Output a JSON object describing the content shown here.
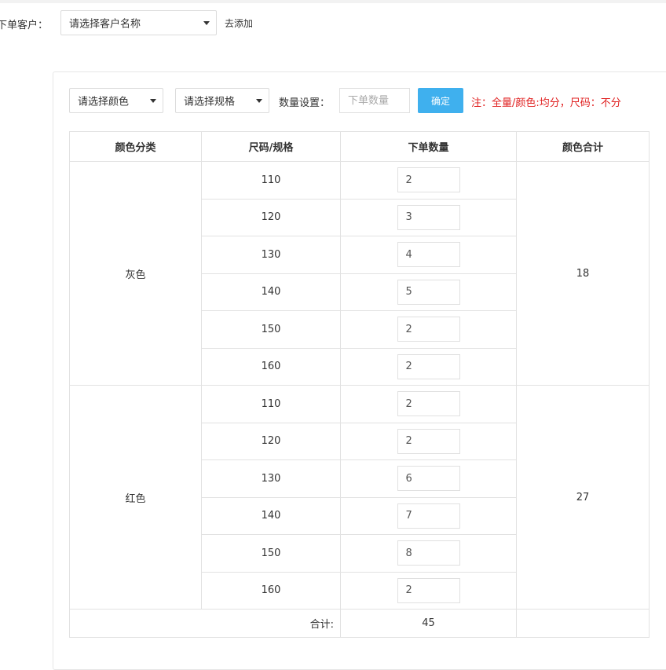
{
  "customer": {
    "label": "下单客户：",
    "select_value": "请选择客户名称",
    "add_link": "去添加"
  },
  "toolbar": {
    "color_select": "请选择颜色",
    "spec_select": "请选择规格",
    "qty_label": "数量设置：",
    "qty_placeholder": "下单数量",
    "confirm_label": "确定",
    "note": "注：全量/颜色:均分，尺码：不分"
  },
  "table": {
    "headers": [
      "颜色分类",
      "尺码/规格",
      "下单数量",
      "颜色合计"
    ],
    "groups": [
      {
        "color": "灰色",
        "subtotal": "18",
        "rows": [
          {
            "size": "110",
            "qty": "2"
          },
          {
            "size": "120",
            "qty": "3"
          },
          {
            "size": "130",
            "qty": "4"
          },
          {
            "size": "140",
            "qty": "5"
          },
          {
            "size": "150",
            "qty": "2"
          },
          {
            "size": "160",
            "qty": "2"
          }
        ]
      },
      {
        "color": "红色",
        "subtotal": "27",
        "rows": [
          {
            "size": "110",
            "qty": "2"
          },
          {
            "size": "120",
            "qty": "2"
          },
          {
            "size": "130",
            "qty": "6"
          },
          {
            "size": "140",
            "qty": "7"
          },
          {
            "size": "150",
            "qty": "8"
          },
          {
            "size": "160",
            "qty": "2"
          }
        ]
      }
    ],
    "total_label": "合计:",
    "total_value": "45"
  },
  "icons": {
    "dropdown": "chevron-down-icon"
  }
}
